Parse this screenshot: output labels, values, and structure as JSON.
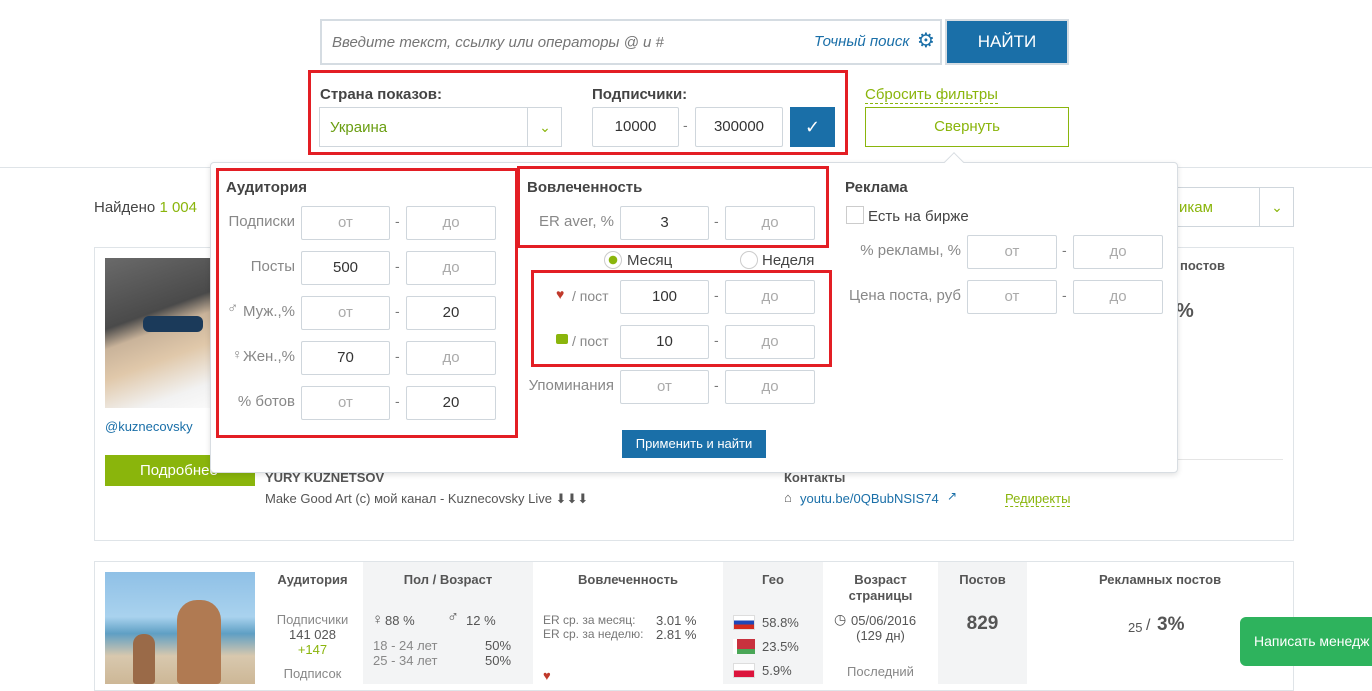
{
  "search": {
    "placeholder": "Введите текст, ссылку или операторы @ и #",
    "exact": "Точный поиск",
    "button": "НАЙТИ"
  },
  "filters": {
    "country_label": "Страна показов:",
    "country_value": "Украина",
    "subs_label": "Подписчики:",
    "subs_from": "10000",
    "subs_to": "300000",
    "reset": "Сбросить фильтры",
    "collapse": "Свернуть"
  },
  "audience": {
    "title": "Аудитория",
    "rows": [
      {
        "label": "Подписки",
        "from": "от",
        "to": "до"
      },
      {
        "label": "Посты",
        "from": "500",
        "to": "до"
      },
      {
        "label": "Муж.,%",
        "from": "от",
        "to": "20"
      },
      {
        "label": "Жен.,%",
        "from": "70",
        "to": "до"
      },
      {
        "label": "% ботов",
        "from": "от",
        "to": "20"
      }
    ]
  },
  "engagement": {
    "title": "Вовлеченность",
    "er_label": "ER aver, %",
    "er_from": "3",
    "er_to": "до",
    "month": "Месяц",
    "week": "Неделя",
    "likes_label": "/ пост",
    "likes_from": "100",
    "likes_to": "до",
    "comments_label": "/ пост",
    "comments_from": "10",
    "comments_to": "до",
    "mentions_label": "Упоминания",
    "mentions_from": "от",
    "mentions_to": "до",
    "apply": "Применить и найти"
  },
  "ads": {
    "title": "Реклама",
    "exchange": "Есть на бирже",
    "pct_label": "% рекламы, %",
    "pct_from": "от",
    "pct_to": "до",
    "price_label": "Цена поста, руб",
    "price_from": "от",
    "price_to": "до"
  },
  "results": {
    "found_prefix": "Найдено",
    "found_count": "1 004",
    "sort_suffix": "икам",
    "dash": "-"
  },
  "card1": {
    "handle": "@kuznecovsky",
    "details": "Подробнее",
    "name": "YURY KUZNETSOV",
    "bio": "Make Good Art (c) мой канал - Kuznecovsky Live ⬇⬇⬇",
    "contacts_title": "Контакты",
    "link": "youtu.be/0QBubNSIS74",
    "redirects": "Редиректы",
    "posts_hdr": "постов",
    "pct": "%"
  },
  "card2": {
    "h_audience": "Аудитория",
    "h_gender": "Пол / Возраст",
    "h_engagement": "Вовлеченность",
    "h_geo": "Гео",
    "h_age": "Возраст страницы",
    "h_posts": "Постов",
    "h_ads": "Рекламных постов",
    "subs_label": "Подписчики",
    "subs": "141 028",
    "subs_delta": "+147",
    "subs_more": "Подписок",
    "female": "88 %",
    "male": "12 %",
    "age1": "18 - 24 лет",
    "age1v": "50%",
    "age2": "25 - 34 лет",
    "age2v": "50%",
    "er_month": "ER ср. за месяц:",
    "er_month_v": "3.01 %",
    "er_week": "ER ср. за неделю:",
    "er_week_v": "2.81 %",
    "geo1": "58.8%",
    "geo2": "23.5%",
    "geo3": "5.9%",
    "date": "05/06/2016",
    "days": "(129 дн)",
    "last": "Последний",
    "posts": "829",
    "ads_count": "25",
    "ads_pct": "3%"
  },
  "chat": {
    "label": "Написать менедж"
  },
  "colors": {
    "blue": "#1a6fa8",
    "green": "#8ab50c",
    "red": "#e31e24"
  }
}
